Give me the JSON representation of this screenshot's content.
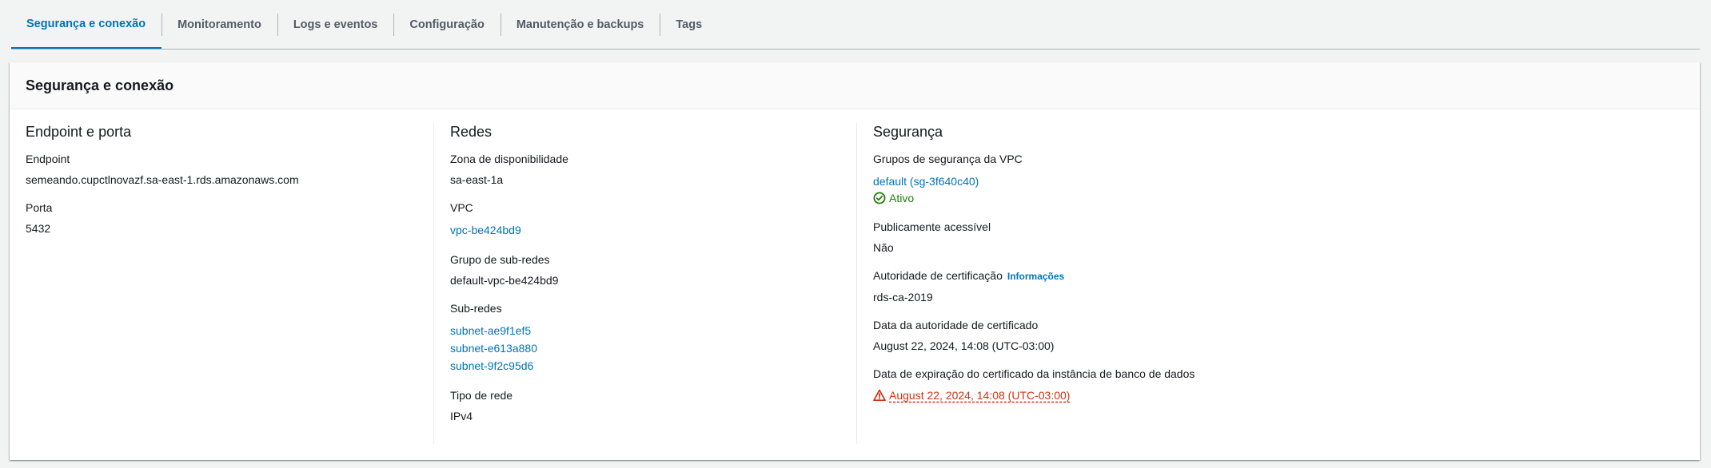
{
  "tabs": [
    {
      "label": "Segurança e conexão",
      "active": true
    },
    {
      "label": "Monitoramento"
    },
    {
      "label": "Logs e eventos"
    },
    {
      "label": "Configuração"
    },
    {
      "label": "Manutenção e backups"
    },
    {
      "label": "Tags"
    }
  ],
  "panel": {
    "title": "Segurança e conexão",
    "endpoint_section": {
      "title": "Endpoint e porta",
      "endpoint_label": "Endpoint",
      "endpoint_value": "semeando.cupctlnovazf.sa-east-1.rds.amazonaws.com",
      "port_label": "Porta",
      "port_value": "5432"
    },
    "network_section": {
      "title": "Redes",
      "az_label": "Zona de disponibilidade",
      "az_value": "sa-east-1a",
      "vpc_label": "VPC",
      "vpc_value": "vpc-be424bd9",
      "subnet_group_label": "Grupo de sub-redes",
      "subnet_group_value": "default-vpc-be424bd9",
      "subnets_label": "Sub-redes",
      "subnets": [
        "subnet-ae9f1ef5",
        "subnet-e613a880",
        "subnet-9f2c95d6"
      ],
      "network_type_label": "Tipo de rede",
      "network_type_value": "IPv4"
    },
    "security_section": {
      "title": "Segurança",
      "vpc_sg_label": "Grupos de segurança da VPC",
      "vpc_sg_value": "default (sg-3f640c40)",
      "vpc_sg_status": "Ativo",
      "public_label": "Publicamente acessível",
      "public_value": "Não",
      "ca_label": "Autoridade de certificação",
      "ca_info": "Informações",
      "ca_value": "rds-ca-2019",
      "ca_date_label": "Data da autoridade de certificado",
      "ca_date_value": "August 22, 2024, 14:08 (UTC-03:00)",
      "cert_exp_label": "Data de expiração do certificado da instância de banco de dados",
      "cert_exp_value": "August 22, 2024, 14:08 (UTC-03:00)"
    }
  },
  "colors": {
    "accent": "#0073bb",
    "success": "#1d8102",
    "warning": "#d13212"
  },
  "icons": {
    "status_ok": "check-circle-icon",
    "status_warn": "warning-triangle-icon"
  }
}
